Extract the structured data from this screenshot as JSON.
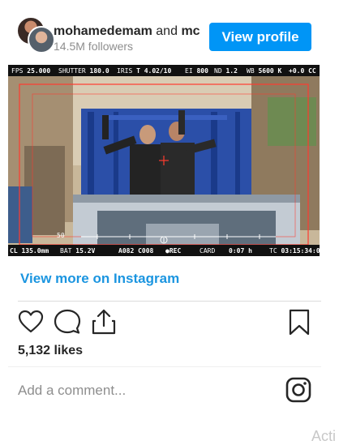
{
  "header": {
    "username": "mohamedemam",
    "and_text": "and",
    "second_user": "mc",
    "followers": "14.5M followers",
    "button_label": "View profile"
  },
  "media": {
    "hud_top": {
      "fps_label": "FPS",
      "fps": "25.000",
      "shutter_label": "SHUTTER",
      "shutter": "180.0",
      "iris_label": "IRIS",
      "iris": "T 4.0",
      "iris_stop": "2/10",
      "ei_label": "EI",
      "ei": "800",
      "nd_label": "ND",
      "nd": "1.2",
      "wb_label": "WB",
      "wb": "5600 K",
      "cc": "+0.0 CC"
    },
    "hud_bottom": {
      "lens": "CL 135.0mm",
      "bat_label": "BAT",
      "bat": "15.2V",
      "clip": "A082 C008",
      "rec": "●REC",
      "card_label": "CARD",
      "time": "0:07 h",
      "tc_label": "TC",
      "tc": "03:15:34:03"
    },
    "scale_marker": "50"
  },
  "view_more_link": "View more on Instagram",
  "actions": {
    "like_icon": "heart-icon",
    "comment_icon": "comment-icon",
    "share_icon": "share-icon",
    "save_icon": "bookmark-icon"
  },
  "likes": "5,132 likes",
  "comment_placeholder": "Add a comment...",
  "instagram_icon": "instagram-icon",
  "watermark": "Acti",
  "colors": {
    "accent": "#0095f6",
    "link": "#1b95e0",
    "rec": "#ff3030"
  }
}
